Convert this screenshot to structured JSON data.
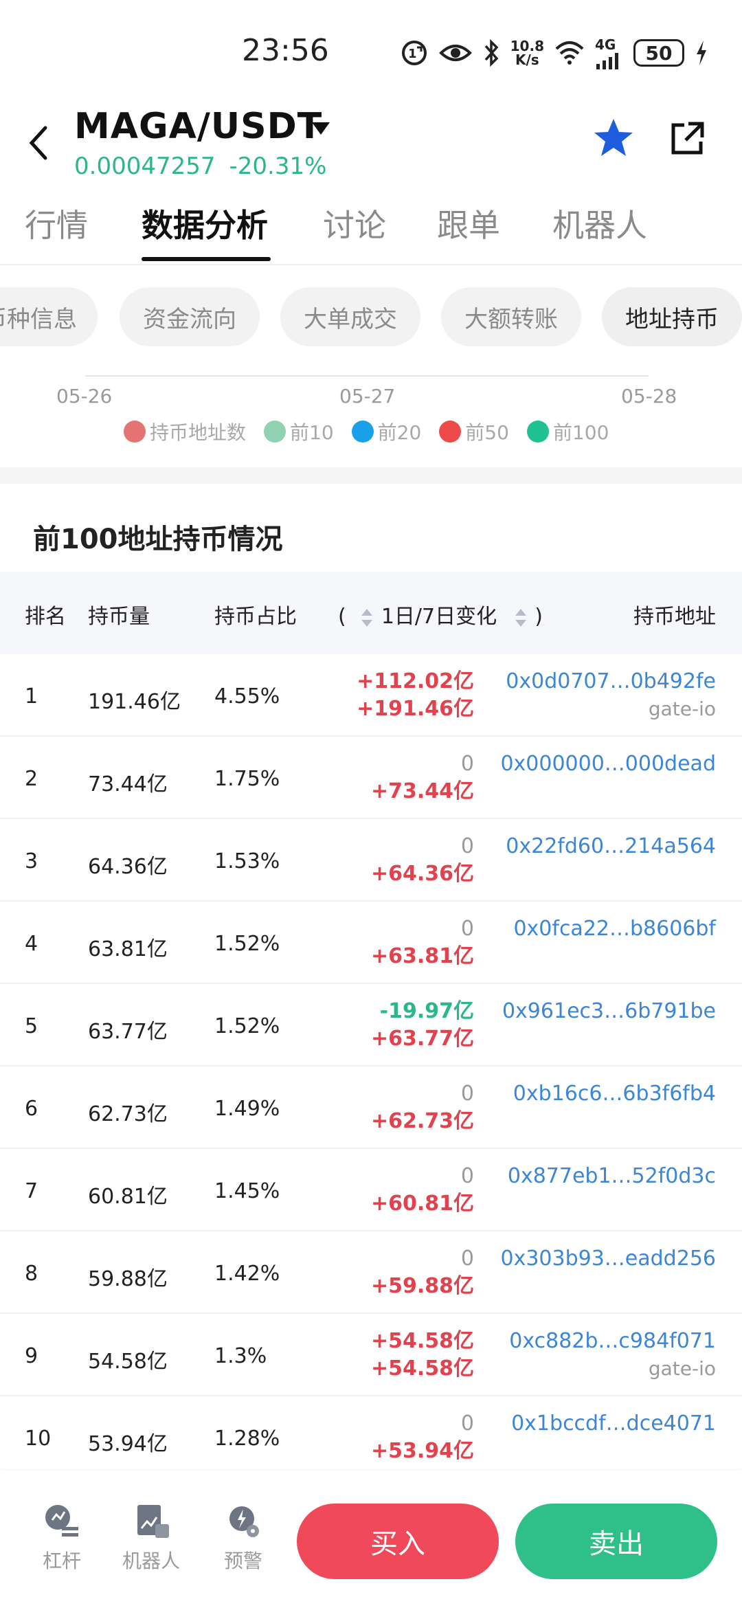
{
  "status_bar": {
    "time": "23:56",
    "speed_top": "10.8",
    "speed_bottom": "K/s",
    "network": "4G",
    "battery": "50"
  },
  "header": {
    "pair": "MAGA/USDT",
    "price": "0.00047257",
    "change": "-20.31%",
    "accent_up": "#e2424d",
    "accent_down": "#2db788"
  },
  "tabs": [
    {
      "label": "行情"
    },
    {
      "label": "数据分析"
    },
    {
      "label": "讨论"
    },
    {
      "label": "跟单"
    },
    {
      "label": "机器人"
    }
  ],
  "chips": [
    {
      "label": "币种信息"
    },
    {
      "label": "资金流向"
    },
    {
      "label": "大单成交"
    },
    {
      "label": "大额转账"
    },
    {
      "label": "地址持币"
    }
  ],
  "chart": {
    "x_ticks": [
      "05-26",
      "05-27",
      "05-28"
    ],
    "legend": [
      {
        "label": "持币地址数",
        "color": "#e57373"
      },
      {
        "label": "前10",
        "color": "#8fd1b0"
      },
      {
        "label": "前20",
        "color": "#1aa0e8"
      },
      {
        "label": "前50",
        "color": "#ef4a4a"
      },
      {
        "label": "前100",
        "color": "#20c193"
      }
    ]
  },
  "section_title": "前100地址持币情况",
  "table": {
    "headers": {
      "rank": "排名",
      "amount": "持币量",
      "ratio": "持币占比",
      "change_open": "(",
      "change": "1日/7日变化",
      "change_close": ")",
      "address": "持币地址"
    },
    "rows": [
      {
        "rank": "1",
        "amount": "191.46亿",
        "ratio": "4.55%",
        "d1": "+112.02亿",
        "d1_dir": "up",
        "d7": "+191.46亿",
        "d7_dir": "up",
        "address": "0x0d0707…0b492fe",
        "tag": "gate-io"
      },
      {
        "rank": "2",
        "amount": "73.44亿",
        "ratio": "1.75%",
        "d1": "0",
        "d1_dir": "zero",
        "d7": "+73.44亿",
        "d7_dir": "up",
        "address": "0x000000…000dead",
        "tag": ""
      },
      {
        "rank": "3",
        "amount": "64.36亿",
        "ratio": "1.53%",
        "d1": "0",
        "d1_dir": "zero",
        "d7": "+64.36亿",
        "d7_dir": "up",
        "address": "0x22fd60…214a564",
        "tag": ""
      },
      {
        "rank": "4",
        "amount": "63.81亿",
        "ratio": "1.52%",
        "d1": "0",
        "d1_dir": "zero",
        "d7": "+63.81亿",
        "d7_dir": "up",
        "address": "0x0fca22…b8606bf",
        "tag": ""
      },
      {
        "rank": "5",
        "amount": "63.77亿",
        "ratio": "1.52%",
        "d1": "-19.97亿",
        "d1_dir": "down",
        "d7": "+63.77亿",
        "d7_dir": "up",
        "address": "0x961ec3…6b791be",
        "tag": ""
      },
      {
        "rank": "6",
        "amount": "62.73亿",
        "ratio": "1.49%",
        "d1": "0",
        "d1_dir": "zero",
        "d7": "+62.73亿",
        "d7_dir": "up",
        "address": "0xb16c6…6b3f6fb4",
        "tag": ""
      },
      {
        "rank": "7",
        "amount": "60.81亿",
        "ratio": "1.45%",
        "d1": "0",
        "d1_dir": "zero",
        "d7": "+60.81亿",
        "d7_dir": "up",
        "address": "0x877eb1…52f0d3c",
        "tag": ""
      },
      {
        "rank": "8",
        "amount": "59.88亿",
        "ratio": "1.42%",
        "d1": "0",
        "d1_dir": "zero",
        "d7": "+59.88亿",
        "d7_dir": "up",
        "address": "0x303b93…eadd256",
        "tag": ""
      },
      {
        "rank": "9",
        "amount": "54.58亿",
        "ratio": "1.3%",
        "d1": "+54.58亿",
        "d1_dir": "up",
        "d7": "+54.58亿",
        "d7_dir": "up",
        "address": "0xc882b…c984f071",
        "tag": "gate-io"
      },
      {
        "rank": "10",
        "amount": "53.94亿",
        "ratio": "1.28%",
        "d1": "0",
        "d1_dir": "zero",
        "d7": "+53.94亿",
        "d7_dir": "up",
        "address": "0x1bccdf…dce4071",
        "tag": ""
      }
    ]
  },
  "bottom_bar": {
    "tools": [
      {
        "label": "杠杆",
        "icon": "leverage-icon"
      },
      {
        "label": "机器人",
        "icon": "robot-icon"
      },
      {
        "label": "预警",
        "icon": "alert-icon"
      }
    ],
    "buy_label": "买入",
    "sell_label": "卖出",
    "buy_color": "#f0495a",
    "sell_color": "#2fc08a"
  }
}
